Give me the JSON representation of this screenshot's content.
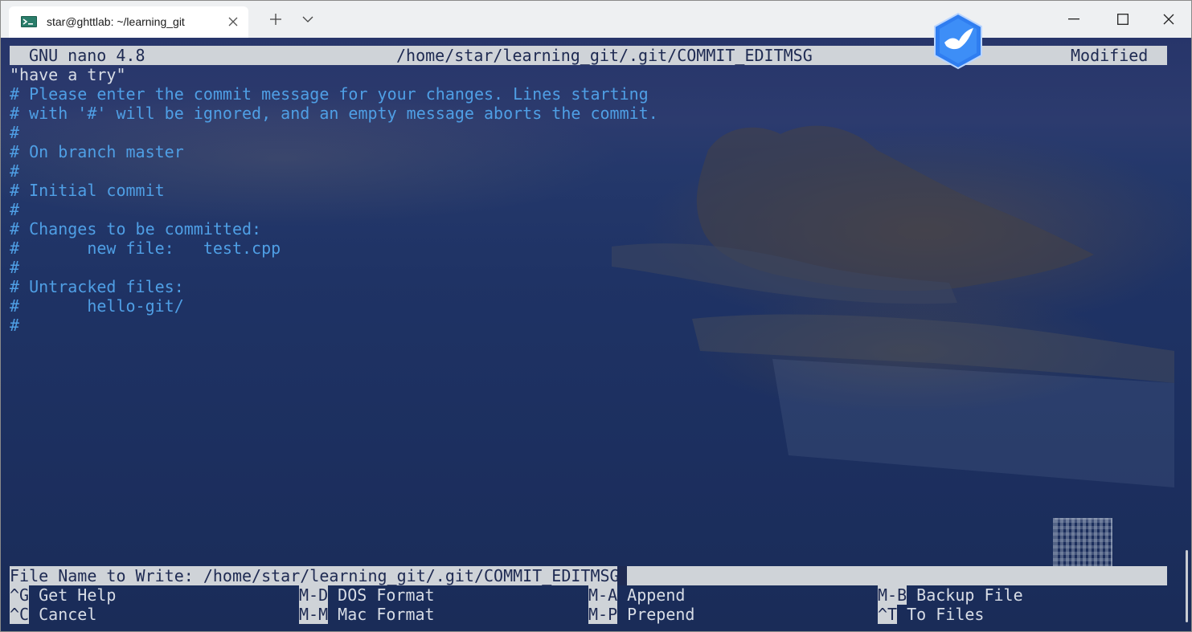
{
  "window": {
    "tab_title": "star@ghttlab: ~/learning_git",
    "tab_icon": "terminal-icon"
  },
  "nano": {
    "version": "GNU nano 4.8",
    "filepath": "/home/star/learning_git/.git/COMMIT_EDITMSG",
    "status": "Modified"
  },
  "editor": {
    "first_line": "\"have a try\"",
    "comment_lines": [
      "# Please enter the commit message for your changes. Lines starting",
      "# with '#' will be ignored, and an empty message aborts the commit.",
      "#",
      "# On branch master",
      "#",
      "# Initial commit",
      "#",
      "# Changes to be committed:",
      "#       new file:   test.cpp",
      "#",
      "# Untracked files:",
      "#       hello-git/",
      "#"
    ]
  },
  "prompt": {
    "text": "File Name to Write: /home/star/learning_git/.git/COMMIT_EDITMSG"
  },
  "shortcuts": {
    "row1": [
      {
        "key": "^G",
        "label": "Get Help"
      },
      {
        "key": "M-D",
        "label": "DOS Format"
      },
      {
        "key": "M-A",
        "label": "Append"
      },
      {
        "key": "M-B",
        "label": "Backup File"
      }
    ],
    "row2": [
      {
        "key": "^C",
        "label": "Cancel"
      },
      {
        "key": "M-M",
        "label": "Mac Format"
      },
      {
        "key": "M-P",
        "label": "Prepend"
      },
      {
        "key": "^T",
        "label": "To Files"
      }
    ]
  },
  "colors": {
    "comment": "#4f9fe5",
    "plain_text": "#d8dde6",
    "bar_bg": "#cfd3d8",
    "bar_fg": "#1e2a52"
  }
}
